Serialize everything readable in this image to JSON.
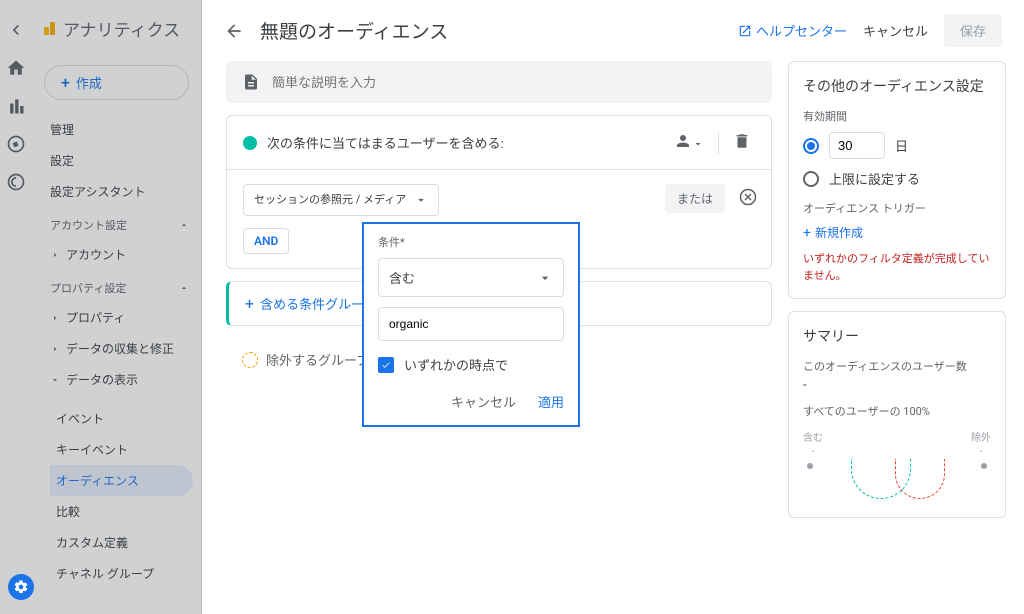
{
  "appTitle": "アナリティクス",
  "createBtn": "作成",
  "nav": {
    "admin": "管理",
    "settings": "設定",
    "setupAssistant": "設定アシスタント",
    "accountSection": "アカウント設定",
    "account": "アカウント",
    "propertySection": "プロパティ設定",
    "property": "プロパティ",
    "dataCollection": "データの収集と修正",
    "dataDisplay": "データの表示",
    "events": "イベント",
    "keyEvents": "キーイベント",
    "audiences": "オーディエンス",
    "compare": "比較",
    "customDef": "カスタム定義",
    "channelGroup": "チャネル グループ"
  },
  "pageTitle": "無題のオーディエンス",
  "helpCenter": "ヘルプセンター",
  "topCancel": "キャンセル",
  "save": "保存",
  "descPlaceholder": "簡単な説明を入力",
  "includeHeader": "次の条件に当てはまるユーザーを含める:",
  "dimension": "セッションの参照元 / メディア",
  "orLabel": "または",
  "andLabel": "AND",
  "addGroup": "含める条件グループを",
  "excludeGroup": "除外するグループを追",
  "settingsTitle": "その他のオーディエンス設定",
  "durationLabel": "有効期間",
  "durationValue": "30",
  "durationUnit": "日",
  "maxOption": "上限に設定する",
  "triggerLabel": "オーディエンス トリガー",
  "newCreate": "新規作成",
  "errMsg": "いずれかのフィルタ定義が完成していません。",
  "summaryTitle": "サマリー",
  "summarySub1": "このオーディエンスのユーザー数",
  "summaryVal1": "-",
  "summarySub2": "すべてのユーザーの 100%",
  "chartInclude": "含む",
  "chartExclude": "除外",
  "popup": {
    "conditionLabel": "条件*",
    "operator": "含む",
    "value": "organic",
    "anyPoint": "いずれかの時点で",
    "cancel": "キャンセル",
    "apply": "適用"
  }
}
